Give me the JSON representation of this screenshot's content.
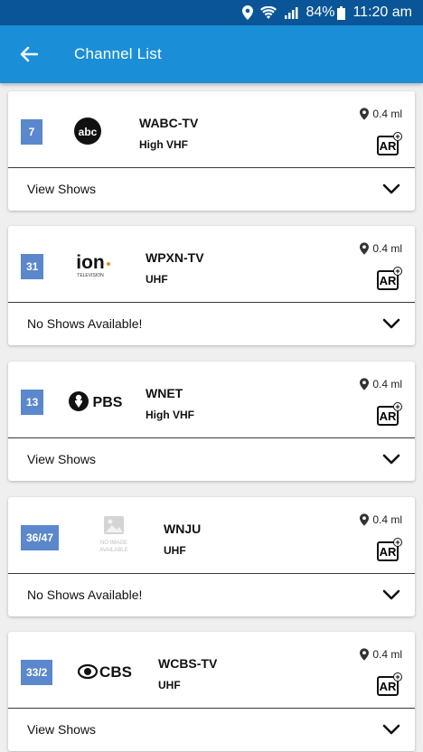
{
  "status_bar": {
    "battery": "84%",
    "time": "11:20 am"
  },
  "header": {
    "title": "Channel List"
  },
  "channels": [
    {
      "number": "7",
      "logo": "abc",
      "call_sign": "WABC-TV",
      "band": "High VHF",
      "distance": "0.4 ml",
      "ar_label": "AR",
      "shows_label": "View Shows"
    },
    {
      "number": "31",
      "logo": "ion",
      "logo_sub": "TELEVISION",
      "call_sign": "WPXN-TV",
      "band": "UHF",
      "distance": "0.4 ml",
      "ar_label": "AR",
      "shows_label": "No Shows Available!"
    },
    {
      "number": "13",
      "logo": "PBS",
      "call_sign": "WNET",
      "band": "High VHF",
      "distance": "0.4 ml",
      "ar_label": "AR",
      "shows_label": "View Shows"
    },
    {
      "number": "36/47",
      "logo_line1": "NO IMAGE",
      "logo_line2": "AVAILABLE",
      "call_sign": "WNJU",
      "band": "UHF",
      "distance": "0.4 ml",
      "ar_label": "AR",
      "shows_label": "No Shows Available!"
    },
    {
      "number": "33/2",
      "logo": "CBS",
      "call_sign": "WCBS-TV",
      "band": "UHF",
      "distance": "0.4 ml",
      "ar_label": "AR",
      "shows_label": "View Shows"
    }
  ]
}
